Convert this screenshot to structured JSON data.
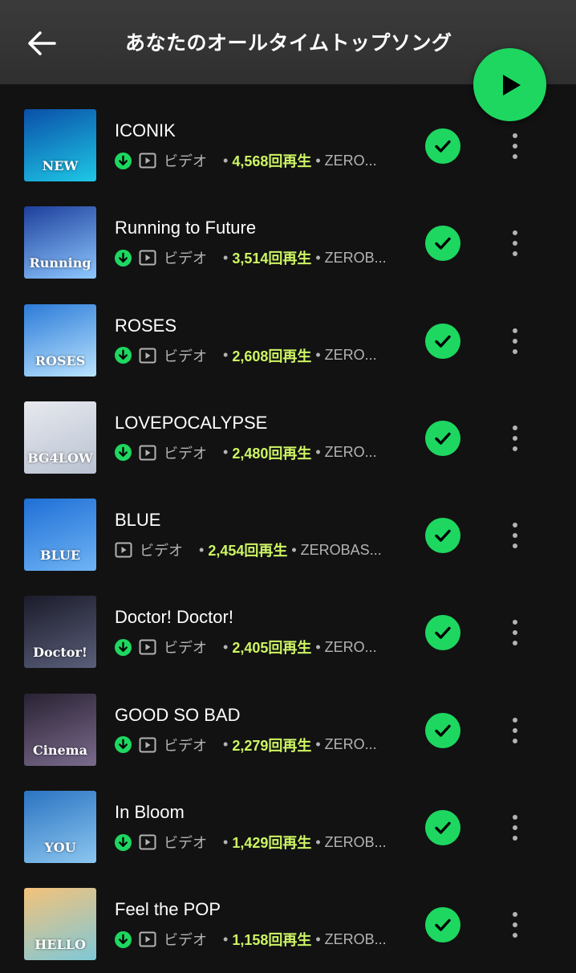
{
  "header": {
    "title": "あなたのオールタイムトップソング"
  },
  "colors": {
    "accent": "#1ed760",
    "plays": "#cdf564",
    "background": "#121212",
    "header": "#333333"
  },
  "tracks": [
    {
      "title": "ICONIK",
      "downloaded": true,
      "video_label": "ビデオ",
      "plays": "4,568回再生",
      "artist": "ZERO...",
      "cover_text": "NEW",
      "cover_colors": [
        "#0a4fa8",
        "#1ec8e6"
      ]
    },
    {
      "title": "Running to Future",
      "downloaded": true,
      "video_label": "ビデオ",
      "plays": "3,514回再生",
      "artist": "ZEROB...",
      "cover_text": "Running",
      "cover_colors": [
        "#1d3f9c",
        "#8ec8ff"
      ]
    },
    {
      "title": "ROSES",
      "downloaded": true,
      "video_label": "ビデオ",
      "plays": "2,608回再生",
      "artist": "ZERO...",
      "cover_text": "ROSES",
      "cover_colors": [
        "#2c7bd8",
        "#b9e3ff"
      ]
    },
    {
      "title": "LOVEPOCALYPSE",
      "downloaded": true,
      "video_label": "ビデオ",
      "plays": "2,480回再生",
      "artist": "ZERO...",
      "cover_text": "BG4LOW",
      "cover_colors": [
        "#e7e9ee",
        "#b9c2d2"
      ]
    },
    {
      "title": "BLUE",
      "downloaded": false,
      "video_label": "ビデオ",
      "plays": "2,454回再生",
      "artist": "ZEROBAS...",
      "cover_text": "BLUE",
      "cover_colors": [
        "#1f6fd6",
        "#6fb4f5"
      ]
    },
    {
      "title": "Doctor! Doctor!",
      "downloaded": true,
      "video_label": "ビデオ",
      "plays": "2,405回再生",
      "artist": "ZERO...",
      "cover_text": "Doctor!",
      "cover_colors": [
        "#1b1b2a",
        "#5a5f7a"
      ]
    },
    {
      "title": "GOOD SO BAD",
      "downloaded": true,
      "video_label": "ビデオ",
      "plays": "2,279回再生",
      "artist": "ZERO...",
      "cover_text": "Cinema",
      "cover_colors": [
        "#2a2233",
        "#7a6b8d"
      ]
    },
    {
      "title": "In Bloom",
      "downloaded": true,
      "video_label": "ビデオ",
      "plays": "1,429回再生",
      "artist": "ZEROB...",
      "cover_text": "YOU",
      "cover_colors": [
        "#2b74c2",
        "#8cc6f0"
      ]
    },
    {
      "title": "Feel the POP",
      "downloaded": true,
      "video_label": "ビデオ",
      "plays": "1,158回再生",
      "artist": "ZEROB...",
      "cover_text": "HELLO",
      "cover_colors": [
        "#f3c27a",
        "#7fc8d8"
      ]
    }
  ],
  "icons": {
    "back": "arrow-left-icon",
    "play": "play-icon",
    "download": "download-icon",
    "video": "video-icon",
    "added": "check-icon",
    "more": "more-vertical-icon"
  }
}
